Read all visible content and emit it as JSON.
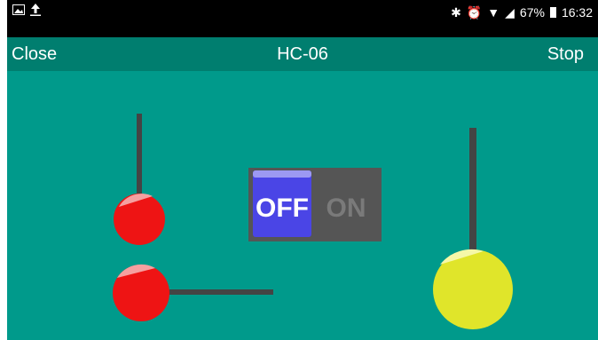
{
  "status_bar": {
    "left_icons": [
      "gallery-icon",
      "upload-icon"
    ],
    "right_icons": [
      "bluetooth-icon",
      "alarm-icon",
      "wifi-icon",
      "signal-icon"
    ],
    "battery": "67%",
    "time": "16:32"
  },
  "app_bar": {
    "close_label": "Close",
    "title": "HC-06",
    "stop_label": "Stop"
  },
  "toggle": {
    "off_label": "OFF",
    "on_label": "ON",
    "state": "off"
  },
  "controls": {
    "slider_vertical_left": {
      "color": "#EE1414",
      "level": 0.0
    },
    "slider_horizontal_bottom": {
      "color": "#EE1414",
      "level": 0.0
    },
    "slider_vertical_right": {
      "color": "#E0E52A",
      "level": 0.0
    }
  },
  "colors": {
    "status_bar": "#000000",
    "app_bar": "#007E6F",
    "background": "#009A8B",
    "track": "#444444",
    "toggle_off": "#4A45E6"
  }
}
